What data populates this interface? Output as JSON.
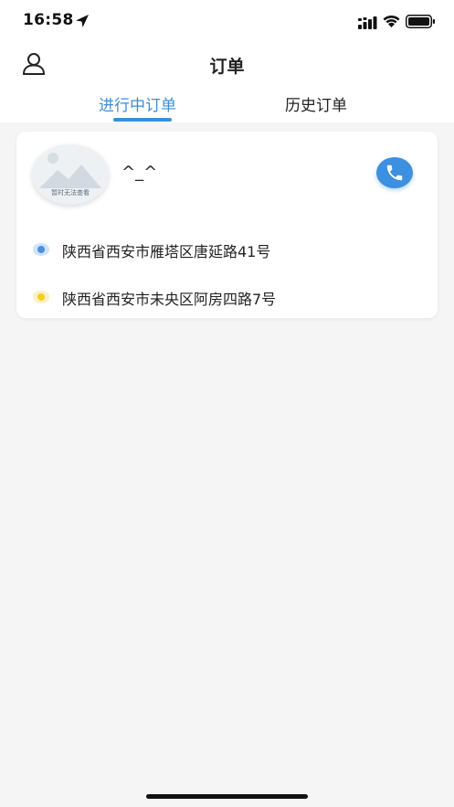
{
  "status_bar": {
    "time": "16:58",
    "icons": [
      "location-arrow-icon",
      "signal-icon",
      "wifi-icon",
      "battery-icon"
    ]
  },
  "nav": {
    "title": "订单",
    "left_icon": "user-icon"
  },
  "tabs": [
    {
      "label": "进行中订单",
      "active": true
    },
    {
      "label": "历史订单",
      "active": false
    }
  ],
  "order": {
    "avatar_caption": "暂时无法查看",
    "driver_name": "^_^",
    "phone_icon": "phone-icon",
    "start_address": "陕西省西安市雁塔区唐延路41号",
    "end_address": "陕西省西安市未央区阿房四路7号"
  },
  "colors": {
    "accent": "#3b8fd6",
    "phone_button": "#3d8fe0",
    "start_dot": "#4a90e2",
    "end_dot": "#f5cf21",
    "background": "#f5f5f5"
  }
}
